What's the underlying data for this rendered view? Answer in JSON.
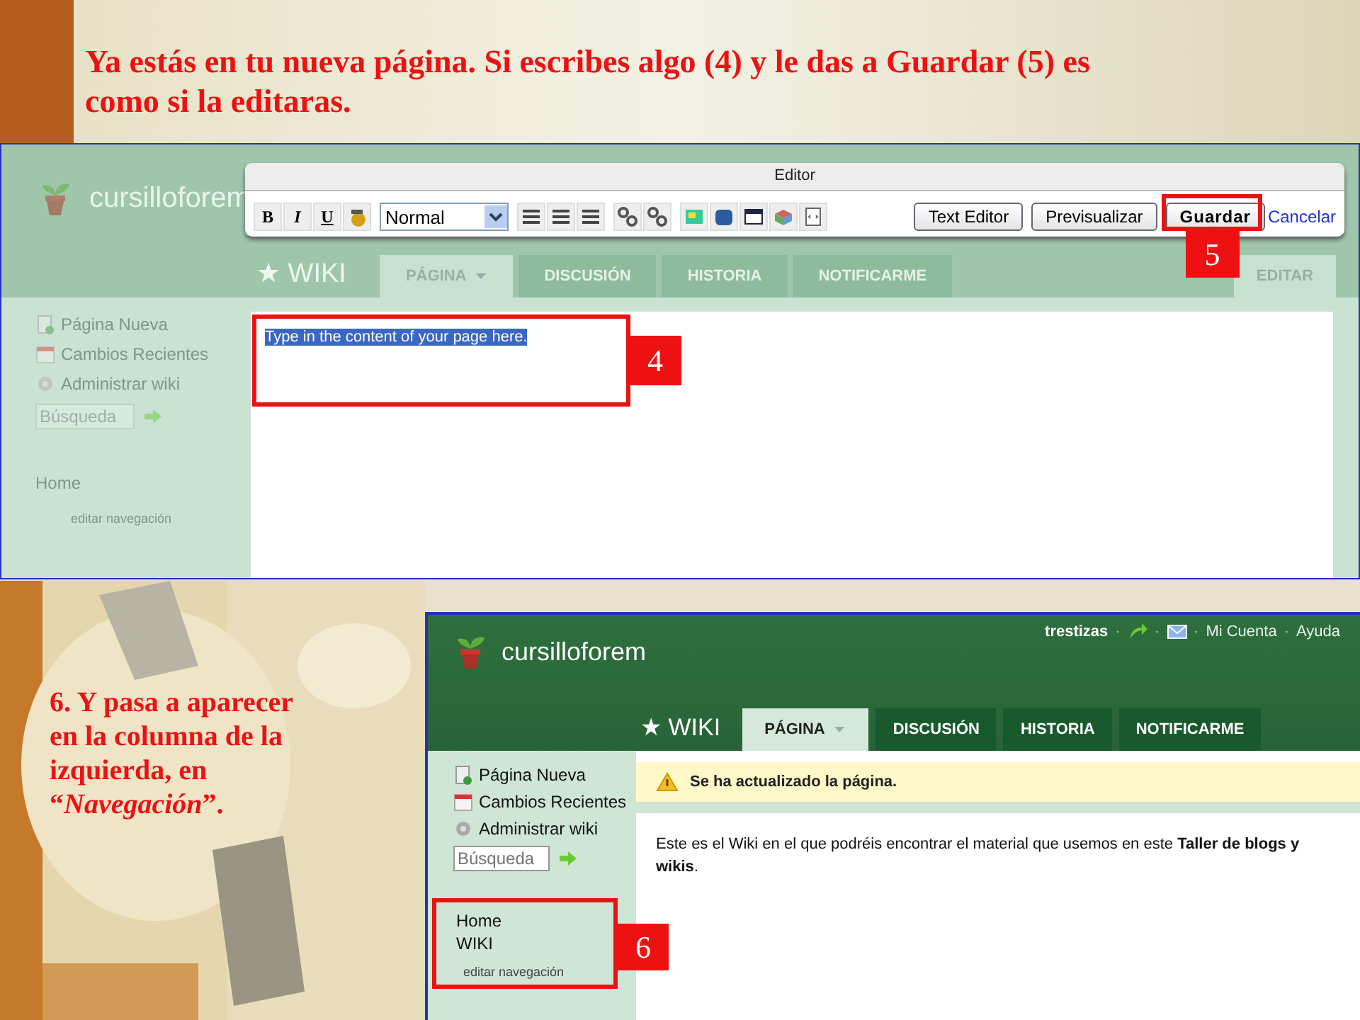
{
  "slide": {
    "caption": "Ya estás en tu nueva página. Si escribes algo (4) y le das a Guardar (5) es como si la editaras.",
    "note": "6. Y pasa a aparecer en la columna de la izquierda, en “*Navegación*”."
  },
  "editor_screenshot": {
    "site_name": "cursilloforem",
    "dialog": {
      "title": "Editor",
      "format_buttons": [
        "B",
        "I",
        "U"
      ],
      "format_select": "Normal",
      "buttons": [
        "Text Editor",
        "Previsualizar",
        "Guardar"
      ],
      "cancel_link": "Cancelar"
    },
    "wiki_label": "★ WIKI",
    "tabs": [
      {
        "label": "PÁGINA",
        "selected": true,
        "dropdown": true
      },
      {
        "label": "DISCUSIÓN",
        "selected": false,
        "dropdown": false
      },
      {
        "label": "HISTORIA",
        "selected": false,
        "dropdown": false
      },
      {
        "label": "NOTIFICARME",
        "selected": false,
        "dropdown": false
      }
    ],
    "edit_tab": "EDITAR",
    "sidebar": [
      {
        "label": "Página Nueva",
        "kind": "page"
      },
      {
        "label": "Cambios Recientes",
        "kind": "calendar"
      },
      {
        "label": "Administrar wiki",
        "kind": "gear"
      }
    ],
    "search_placeholder": "Búsqueda",
    "navigation": [
      "Home"
    ],
    "edit_navigation": "editar navegación",
    "content": {
      "text": "Type in the content of your page here.",
      "selected": true
    },
    "callouts": [
      "4",
      "5"
    ]
  },
  "saved_screenshot": {
    "site_name": "cursilloforem",
    "user": "trestizas",
    "links": [
      "Mi Cuenta",
      "Ayuda"
    ],
    "separator": "·",
    "wiki_label": "★ WIKI",
    "tabs": [
      {
        "label": "PÁGINA",
        "selected": true,
        "dropdown": true
      },
      {
        "label": "DISCUSIÓN",
        "selected": false,
        "dropdown": false
      },
      {
        "label": "HISTORIA",
        "selected": false,
        "dropdown": false
      },
      {
        "label": "NOTIFICARME",
        "selected": false,
        "dropdown": false
      }
    ],
    "sidebar": [
      {
        "label": "Página Nueva",
        "kind": "page"
      },
      {
        "label": "Cambios Recientes",
        "kind": "calendar"
      },
      {
        "label": "Administrar wiki",
        "kind": "gear"
      }
    ],
    "search_placeholder": "Búsqueda",
    "navigation": [
      "Home",
      "WIKI"
    ],
    "edit_navigation": "editar navegación",
    "alert": "Se ha actualizado la página.",
    "body": "Este es el Wiki en el que podréis encontrar el material que usemos en este **Taller de blogs y wikis**.",
    "callout": "6"
  }
}
